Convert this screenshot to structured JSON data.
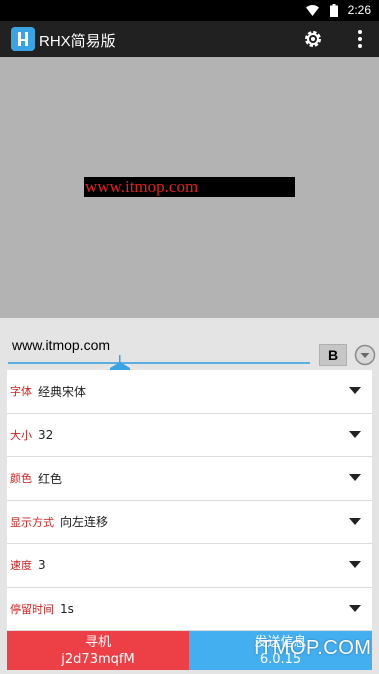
{
  "status_bar": {
    "time": "2:26",
    "icons": [
      "wifi-icon",
      "battery-icon"
    ]
  },
  "app_bar": {
    "title": "RHX简易版",
    "icons": [
      "app-logo-icon",
      "gear-icon",
      "more-vert-icon"
    ]
  },
  "preview": {
    "marquee_text": "www.itmop.com",
    "text_color": "#e02020",
    "background": "#000000"
  },
  "editor": {
    "input_value": "www.itmop.com",
    "bold_label": "B"
  },
  "settings": [
    {
      "label": "字体",
      "value": "经典宋体"
    },
    {
      "label": "大小",
      "value": "32"
    },
    {
      "label": "颜色",
      "value": "红色"
    },
    {
      "label": "显示方式",
      "value": "向左连移"
    },
    {
      "label": "速度",
      "value": "3"
    },
    {
      "label": "停留时间",
      "value": "1s"
    }
  ],
  "buttons": {
    "find": {
      "title": "寻机",
      "subtitle": "j2d73mqfM",
      "color": "#ec4046"
    },
    "send": {
      "title": "发送信息",
      "subtitle": "6.0.15",
      "color": "#43aef0"
    }
  },
  "watermark": "ITMOP.COM"
}
